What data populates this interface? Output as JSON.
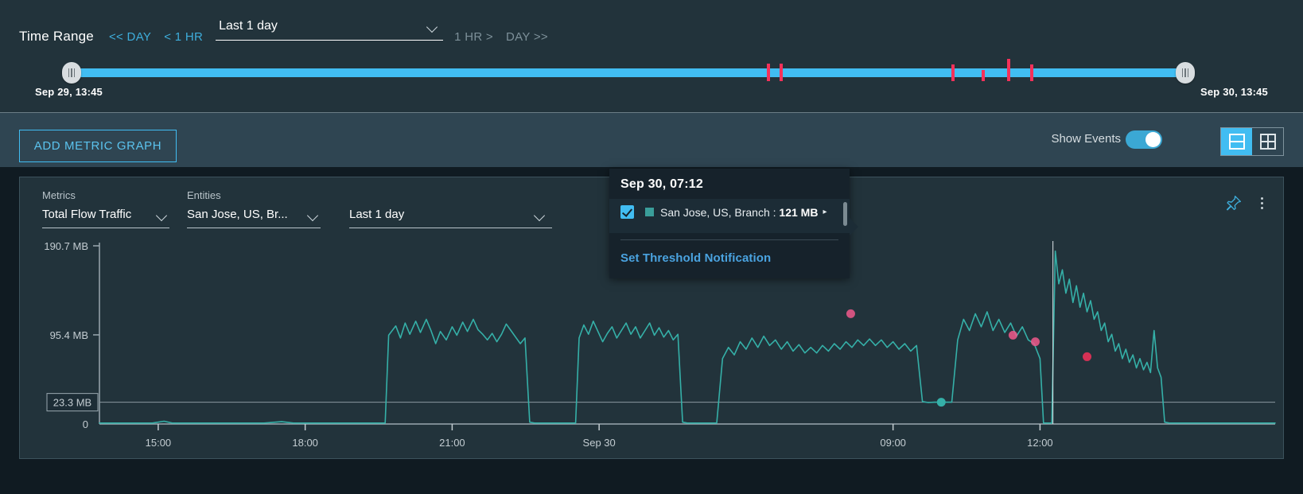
{
  "time_range": {
    "title": "Time Range",
    "nav_prev_day": "<< DAY",
    "nav_prev_hour": "< 1 HR",
    "selected_range": "Last 1 day",
    "nav_next_hour": "1 HR >",
    "nav_next_day": "DAY >>",
    "start_label": "Sep 29, 13:45",
    "end_label": "Sep 30, 13:45",
    "event_markers": [
      {
        "pos_pct": 62.4,
        "height": 22,
        "top": 2
      },
      {
        "pos_pct": 63.6,
        "height": 22,
        "top": 2
      },
      {
        "pos_pct": 79.0,
        "height": 21,
        "top": 3
      },
      {
        "pos_pct": 81.7,
        "height": 14,
        "top": 10
      },
      {
        "pos_pct": 84.0,
        "height": 28,
        "top": -4
      },
      {
        "pos_pct": 86.1,
        "height": 21,
        "top": 3
      }
    ],
    "track_color": "#41bdf2",
    "event_color": "#f5315a"
  },
  "toolbar": {
    "add_metric_graph": "ADD METRIC GRAPH",
    "show_events_label": "Show Events",
    "show_events_on": true,
    "layout_rows_selected": true,
    "accent_color": "#41bdf2"
  },
  "graph_card": {
    "metrics_label": "Metrics",
    "metrics_value": "Total Flow Traffic",
    "entities_label": "Entities",
    "entities_value": "San Jose, US, Br...",
    "range_value": "Last 1 day",
    "pin_icon": "pin-icon",
    "menu_icon": "kebab-menu-icon"
  },
  "tooltip": {
    "timestamp": "Sep 30, 07:12",
    "series_checked": true,
    "series_color": "#3a9e9a",
    "series_name": "San Jose, US, Branch",
    "series_separator": " : ",
    "series_value": "121 MB",
    "expand_arrow": "▸",
    "link_label": "Set Threshold Notification"
  },
  "chart_data": {
    "type": "line",
    "title": "Total Flow Traffic",
    "xlabel": "",
    "ylabel": "",
    "series_name": "San Jose, US, Branch",
    "line_color": "#35b0a8",
    "ylim": [
      0,
      190.7
    ],
    "ytick_values": [
      190.7,
      95.4,
      0
    ],
    "ytick_labels": [
      "190.7 MB",
      "95.4 MB",
      "0"
    ],
    "threshold": {
      "value": 23.3,
      "label": "23.3 MB",
      "color": "#8c9aa2"
    },
    "xtick_labels": [
      "15:00",
      "18:00",
      "21:00",
      "Sep 30",
      "09:00",
      "12:00"
    ],
    "xtick_positions_pct": [
      5.0,
      17.5,
      30.0,
      42.5,
      67.5,
      80.0
    ],
    "highlight_points": [
      {
        "x_pct": 63.9,
        "y_mb": 118,
        "color": "#f0598c"
      },
      {
        "x_pct": 77.7,
        "y_mb": 95,
        "color": "#f0598c"
      },
      {
        "x_pct": 79.6,
        "y_mb": 88,
        "color": "#f0598c"
      },
      {
        "x_pct": 84.0,
        "y_mb": 72,
        "color": "#f5315a"
      },
      {
        "x_pct": 71.6,
        "y_mb": 23.3,
        "color": "#35b0a8"
      }
    ],
    "points": [
      [
        0.0,
        1
      ],
      [
        1.5,
        1
      ],
      [
        3.0,
        1
      ],
      [
        4.5,
        1
      ],
      [
        5.5,
        3
      ],
      [
        6.2,
        1
      ],
      [
        8.0,
        1
      ],
      [
        10.0,
        1
      ],
      [
        12.0,
        1
      ],
      [
        14.0,
        1
      ],
      [
        15.5,
        2.5
      ],
      [
        16.5,
        1
      ],
      [
        18.0,
        1
      ],
      [
        20.0,
        1
      ],
      [
        22.0,
        1
      ],
      [
        24.0,
        1
      ],
      [
        24.3,
        1
      ],
      [
        24.6,
        95
      ],
      [
        25.2,
        105
      ],
      [
        25.6,
        92
      ],
      [
        26.0,
        108
      ],
      [
        26.4,
        96
      ],
      [
        26.9,
        110
      ],
      [
        27.3,
        98
      ],
      [
        27.8,
        112
      ],
      [
        28.2,
        100
      ],
      [
        28.6,
        86
      ],
      [
        29.0,
        99
      ],
      [
        29.5,
        90
      ],
      [
        30.0,
        104
      ],
      [
        30.4,
        95
      ],
      [
        30.9,
        109
      ],
      [
        31.3,
        99
      ],
      [
        31.8,
        112
      ],
      [
        32.2,
        101
      ],
      [
        32.6,
        96
      ],
      [
        33.0,
        90
      ],
      [
        33.4,
        97
      ],
      [
        33.8,
        88
      ],
      [
        34.2,
        96
      ],
      [
        34.6,
        107
      ],
      [
        35.0,
        100
      ],
      [
        35.4,
        93
      ],
      [
        35.8,
        86
      ],
      [
        36.2,
        92
      ],
      [
        36.6,
        2
      ],
      [
        37.0,
        1
      ],
      [
        38.5,
        1
      ],
      [
        39.8,
        1
      ],
      [
        40.5,
        1
      ],
      [
        40.8,
        92
      ],
      [
        41.2,
        106
      ],
      [
        41.6,
        96
      ],
      [
        42.0,
        110
      ],
      [
        42.4,
        99
      ],
      [
        42.8,
        88
      ],
      [
        43.2,
        97
      ],
      [
        43.6,
        104
      ],
      [
        44.0,
        92
      ],
      [
        44.4,
        100
      ],
      [
        44.8,
        108
      ],
      [
        45.2,
        96
      ],
      [
        45.6,
        104
      ],
      [
        46.0,
        92
      ],
      [
        46.4,
        100
      ],
      [
        46.8,
        108
      ],
      [
        47.2,
        95
      ],
      [
        47.6,
        103
      ],
      [
        48.0,
        93
      ],
      [
        48.4,
        100
      ],
      [
        48.8,
        90
      ],
      [
        49.2,
        96
      ],
      [
        49.6,
        2
      ],
      [
        50.0,
        1
      ],
      [
        51.0,
        1
      ],
      [
        52.0,
        1
      ],
      [
        52.5,
        1
      ],
      [
        53.0,
        70
      ],
      [
        53.5,
        82
      ],
      [
        54.0,
        74
      ],
      [
        54.5,
        88
      ],
      [
        55.0,
        80
      ],
      [
        55.5,
        92
      ],
      [
        56.0,
        82
      ],
      [
        56.5,
        94
      ],
      [
        57.0,
        84
      ],
      [
        57.5,
        90
      ],
      [
        58.0,
        80
      ],
      [
        58.5,
        88
      ],
      [
        59.0,
        78
      ],
      [
        59.5,
        85
      ],
      [
        60.0,
        76
      ],
      [
        60.5,
        82
      ],
      [
        61.0,
        76
      ],
      [
        61.5,
        84
      ],
      [
        62.0,
        78
      ],
      [
        62.5,
        86
      ],
      [
        63.0,
        80
      ],
      [
        63.5,
        88
      ],
      [
        64.0,
        82
      ],
      [
        64.5,
        90
      ],
      [
        65.0,
        84
      ],
      [
        65.5,
        91
      ],
      [
        66.0,
        84
      ],
      [
        66.5,
        90
      ],
      [
        67.0,
        82
      ],
      [
        67.5,
        88
      ],
      [
        68.0,
        80
      ],
      [
        68.5,
        86
      ],
      [
        69.0,
        78
      ],
      [
        69.5,
        84
      ],
      [
        70.0,
        24
      ],
      [
        70.5,
        23
      ],
      [
        71.0,
        23.3
      ],
      [
        71.5,
        23.3
      ],
      [
        72.0,
        23.3
      ],
      [
        72.5,
        23.3
      ],
      [
        73.0,
        90
      ],
      [
        73.5,
        112
      ],
      [
        74.0,
        100
      ],
      [
        74.5,
        118
      ],
      [
        75.0,
        104
      ],
      [
        75.5,
        120
      ],
      [
        76.0,
        100
      ],
      [
        76.5,
        112
      ],
      [
        77.0,
        98
      ],
      [
        77.5,
        108
      ],
      [
        78.0,
        94
      ],
      [
        78.5,
        104
      ],
      [
        79.0,
        90
      ],
      [
        79.5,
        86
      ],
      [
        80.0,
        70
      ],
      [
        80.3,
        1
      ],
      [
        80.6,
        1
      ],
      [
        81.0,
        1
      ],
      [
        81.3,
        185
      ],
      [
        81.6,
        150
      ],
      [
        81.9,
        165
      ],
      [
        82.2,
        140
      ],
      [
        82.5,
        155
      ],
      [
        82.8,
        130
      ],
      [
        83.1,
        148
      ],
      [
        83.4,
        125
      ],
      [
        83.7,
        140
      ],
      [
        84.0,
        120
      ],
      [
        84.3,
        132
      ],
      [
        84.6,
        112
      ],
      [
        84.9,
        120
      ],
      [
        85.2,
        100
      ],
      [
        85.5,
        108
      ],
      [
        85.8,
        88
      ],
      [
        86.1,
        96
      ],
      [
        86.4,
        78
      ],
      [
        86.7,
        86
      ],
      [
        87.0,
        70
      ],
      [
        87.3,
        80
      ],
      [
        87.6,
        66
      ],
      [
        87.9,
        74
      ],
      [
        88.2,
        60
      ],
      [
        88.5,
        70
      ],
      [
        88.8,
        58
      ],
      [
        89.1,
        66
      ],
      [
        89.4,
        55
      ],
      [
        89.7,
        100
      ],
      [
        90.0,
        60
      ],
      [
        90.3,
        50
      ],
      [
        90.6,
        2
      ],
      [
        91.0,
        1
      ],
      [
        92.0,
        1
      ],
      [
        94.0,
        1
      ],
      [
        96.0,
        1
      ],
      [
        98.0,
        1
      ],
      [
        100.0,
        1
      ]
    ]
  }
}
